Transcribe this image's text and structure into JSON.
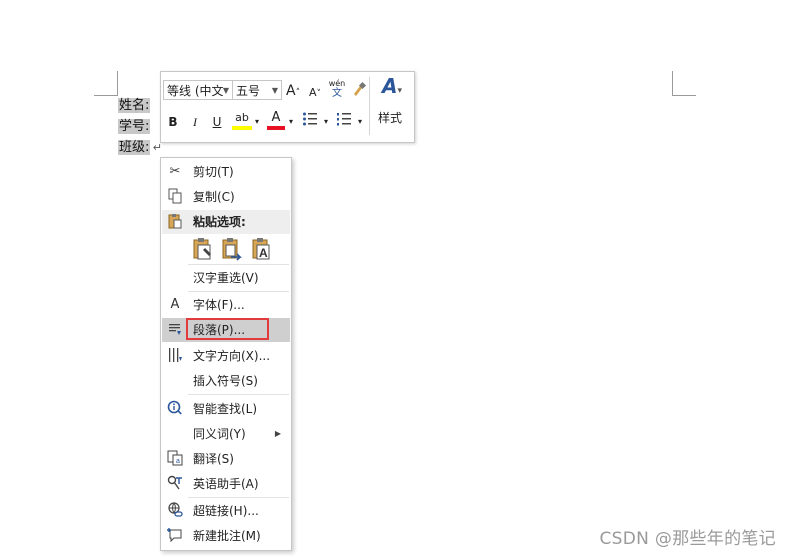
{
  "document": {
    "lines": [
      "姓名:",
      "学号:",
      "班级:"
    ],
    "paragraph_mark": "↵"
  },
  "mini_toolbar": {
    "font_name": "等线 (中文",
    "font_size": "五号",
    "grow_font": "A",
    "shrink_font": "A",
    "phonetic_top": "wén",
    "phonetic_bottom": "文",
    "bold": "B",
    "italic": "I",
    "underline": "U",
    "highlight": "ab",
    "font_color": "A",
    "styles_label": "样式",
    "styles_icon_text": "A"
  },
  "context_menu": {
    "items": [
      {
        "label": "剪切(T)",
        "icon": "scissors-icon"
      },
      {
        "label": "复制(C)",
        "icon": "copy-icon"
      },
      {
        "label": "粘贴选项:",
        "icon": "clipboard-icon"
      },
      {
        "label": "汉字重选(V)",
        "icon": ""
      },
      {
        "label": "字体(F)...",
        "icon": "font-icon",
        "icon_text": "A"
      },
      {
        "label": "段落(P)...",
        "icon": "paragraph-icon"
      },
      {
        "label": "文字方向(X)...",
        "icon": "text-direction-icon"
      },
      {
        "label": "插入符号(S)",
        "icon": ""
      },
      {
        "label": "智能查找(L)",
        "icon": "info-search-icon"
      },
      {
        "label": "同义词(Y)",
        "icon": "",
        "submenu": true
      },
      {
        "label": "翻译(S)",
        "icon": "translate-icon"
      },
      {
        "label": "英语助手(A)",
        "icon": "english-assistant-icon"
      },
      {
        "label": "超链接(H)...",
        "icon": "hyperlink-icon"
      },
      {
        "label": "新建批注(M)",
        "icon": "new-comment-icon"
      }
    ],
    "submenu_arrow": "▶"
  },
  "colors": {
    "highlight_yellow": "#ffff00",
    "font_red": "#e81123",
    "annotation_red": "#e23b3b",
    "accent_blue": "#2b579a"
  },
  "watermark": "CSDN @那些年的笔记"
}
